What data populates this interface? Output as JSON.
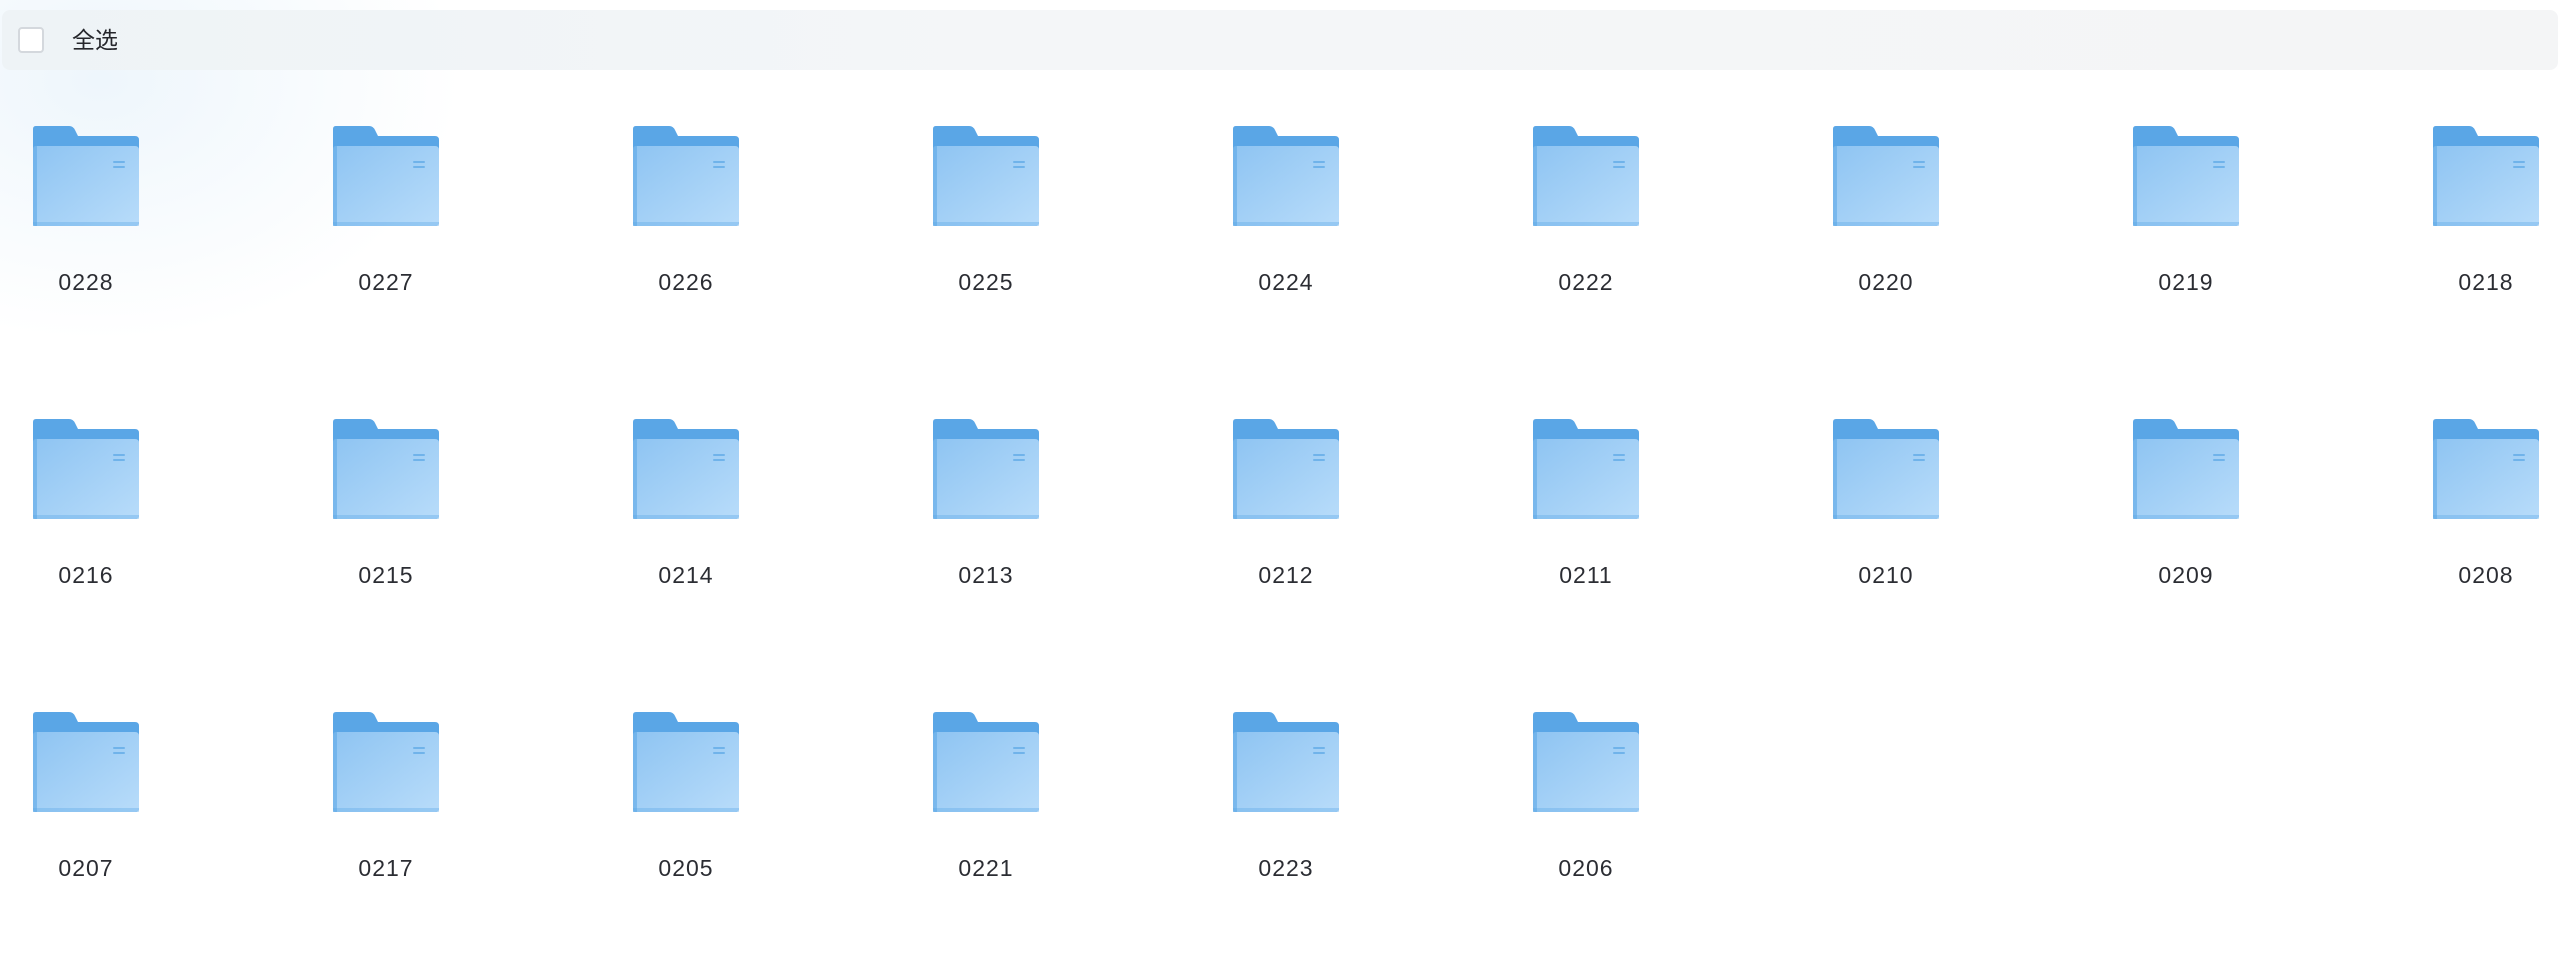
{
  "toolbar": {
    "select_all_label": "全选"
  },
  "colors": {
    "folder_back": "#5aa6e6",
    "folder_front_top": "#8ec4f2",
    "folder_front_bottom": "#b8dcfa",
    "label_text": "#2b2d33"
  },
  "folders": [
    {
      "name": "0228"
    },
    {
      "name": "0227"
    },
    {
      "name": "0226"
    },
    {
      "name": "0225"
    },
    {
      "name": "0224"
    },
    {
      "name": "0222"
    },
    {
      "name": "0220"
    },
    {
      "name": "0219"
    },
    {
      "name": "0218"
    },
    {
      "name": "0216"
    },
    {
      "name": "0215"
    },
    {
      "name": "0214"
    },
    {
      "name": "0213"
    },
    {
      "name": "0212"
    },
    {
      "name": "0211"
    },
    {
      "name": "0210"
    },
    {
      "name": "0209"
    },
    {
      "name": "0208"
    },
    {
      "name": "0207"
    },
    {
      "name": "0217"
    },
    {
      "name": "0205"
    },
    {
      "name": "0221"
    },
    {
      "name": "0223"
    },
    {
      "name": "0206"
    }
  ]
}
